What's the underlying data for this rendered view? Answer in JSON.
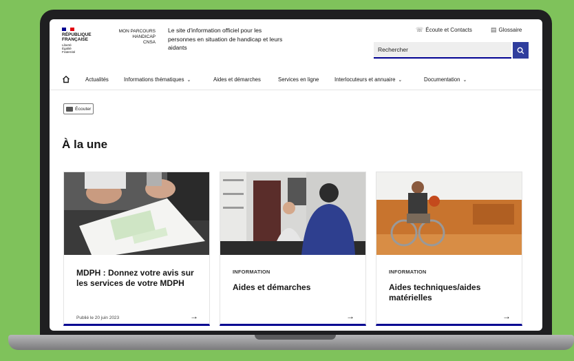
{
  "brand": {
    "rf_text": "RÉPUBLIQUE\nFRANÇAISE",
    "rf_small": "Liberté\nÉgalité\nFraternité",
    "mph_text": "MON PARCOURS\nHANDICAP\nCNSA",
    "tagline": "Le site d'information officiel pour les personnes en situation de handicap et leurs aidants"
  },
  "toplinks": {
    "contact": "Écoute et Contacts",
    "glossary": "Glossaire"
  },
  "search": {
    "placeholder": "Rechercher"
  },
  "nav": {
    "items": [
      {
        "label": "Actualités",
        "dropdown": false
      },
      {
        "label": "Informations thématiques",
        "dropdown": true
      },
      {
        "label": "Aides et démarches",
        "dropdown": false
      },
      {
        "label": "Services en ligne",
        "dropdown": false
      },
      {
        "label": "Interlocuteurs et annuaire",
        "dropdown": true
      },
      {
        "label": "Documentation",
        "dropdown": true
      }
    ]
  },
  "listen_label": "Écouter",
  "section_title": "À la une",
  "cards": [
    {
      "badge": "",
      "title": "MDPH : Donnez votre avis sur les services de votre MDPH",
      "date": "Publié le 20 juin 2023"
    },
    {
      "badge": "INFORMATION",
      "title": "Aides et démarches",
      "date": ""
    },
    {
      "badge": "INFORMATION",
      "title": "Aides techniques/aides matérielles",
      "date": ""
    }
  ],
  "colors": {
    "accent": "#000091",
    "background": "#7fc25b"
  },
  "icons": [
    "home-icon",
    "search-icon",
    "headset-icon",
    "glossary-icon",
    "arrow-right-icon",
    "chevron-down-icon",
    "listen-icon"
  ]
}
